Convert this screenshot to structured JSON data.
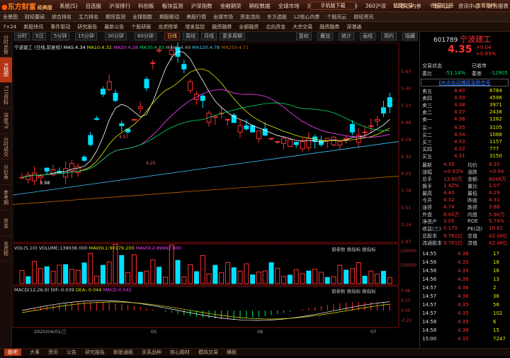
{
  "app": {
    "logo": "东方财富",
    "edition": "经典版",
    "quick_trade": "快捷交易",
    "login": "登录/注册",
    "user": "查看账户",
    "phone_download": "手机版下载"
  },
  "menu": [
    "系统(S)",
    "自选股",
    "沪深排行",
    "科创板",
    "板块监测",
    "沪深指数",
    "金融期货",
    "期权数据",
    "全球市场",
    "沪深港通",
    "美股市场",
    "360沪深",
    "L2核心内参",
    "个股风云",
    "资讯中心",
    "财务报表"
  ],
  "navbar": [
    "全景图",
    "财经要闻",
    "综合排名",
    "主力排名",
    "期货监测",
    "全球指数",
    "期股联动",
    "美股行情",
    "全球市场",
    "资金流向",
    "东方选股",
    "L2核心内参",
    "个股风云",
    "财经资讯",
    "7×24",
    "新股快讯",
    "事件驱动",
    "研究报告",
    "最新公告",
    "个股研报",
    "龙虎榜单",
    "增发监控",
    "融资融券",
    "全部融资",
    "北向资金",
    "大宗交易",
    "融资融券",
    "深港通"
  ],
  "left_tabs": [
    "分时走势",
    "K线图",
    "F10资料",
    "深度F9",
    "分时成交",
    "分价表",
    "参考期",
    "资金",
    "龙虎榜"
  ],
  "toolbar": {
    "items": [
      "分时",
      "5日",
      "5分钟",
      "15分钟",
      "30分钟",
      "60分钟",
      "日线",
      "周线",
      "月线",
      "更多周期"
    ],
    "active": "日线",
    "right_items": [
      "复权",
      "叠加",
      "统计",
      "画线",
      "简约",
      "隐藏"
    ]
  },
  "legend": {
    "stock": "宁波建工",
    "period": "(日线,前复权)",
    "ma": "MA",
    "ma5": "MA5:4.34",
    "ma10": "MA10:4.32",
    "ma20": "MA20:4.28",
    "ma30": "MA30:4.33",
    "ma60": "MA60:4.49",
    "ma120": "MA120:4.78",
    "ma250": "MA250:4.71"
  },
  "chart_annotations": {
    "high": "6.21",
    "low": "3.98",
    "mid_left": "4.57",
    "mid_low": "4.25"
  },
  "price_axis": [
    "5.67",
    "5.40",
    "5.13",
    "4.86",
    "4.59",
    "4.32",
    "4.05",
    "3.78",
    "3.51",
    "3.24",
    "2.97"
  ],
  "volume": {
    "label": "VOL(5,10)",
    "volume": "VOLUME:139038.000",
    "mavol1": "MAVOL1:90179.200",
    "mavol2": "MAVOL2:89962.800",
    "axis": [
      "200000",
      "100000"
    ]
  },
  "macd": {
    "label": "MACD(12,26,9)",
    "dif": "DIF:-0.039",
    "dea": "DEA:-0.044",
    "macd": "MACD:0.042",
    "axis": [
      "0.46",
      "0.23",
      "0.00",
      "-0.23"
    ]
  },
  "date_axis": [
    "2020/04/01/三",
    "05",
    "06",
    "07"
  ],
  "bottom_tabs": [
    "股吧",
    "大事",
    "资讯",
    "公告",
    "研究报告",
    "新股通板",
    "关系品种",
    "核心题材",
    "模拟交易",
    "横板"
  ],
  "panel_tools": [
    "窗参数",
    "换指标",
    "换指标"
  ],
  "quote": {
    "code": "601789",
    "name": "宁波建工",
    "price": "4.35",
    "change": "+0.04",
    "change_pct": "+0.93%",
    "status_label": "交易状态",
    "status_value": "已收市",
    "ratio_label": "委比",
    "ratio_value": "-51.14%",
    "diff_label": "委差",
    "diff_value": "-12905"
  },
  "signal": "DK点自动捕捉涨跌信号",
  "asks": [
    [
      "卖五",
      "4.40",
      "6784"
    ],
    [
      "卖四",
      "4.39",
      "4596"
    ],
    [
      "卖三",
      "4.38",
      "3971"
    ],
    [
      "卖二",
      "4.37",
      "2438"
    ],
    [
      "卖一",
      "4.36",
      "1282"
    ]
  ],
  "bids": [
    [
      "买一",
      "4.35",
      "3105"
    ],
    [
      "买二",
      "4.34",
      "1088"
    ],
    [
      "买三",
      "4.33",
      "1157"
    ],
    [
      "买四",
      "4.32",
      "777"
    ],
    [
      "买五",
      "4.31",
      "3150"
    ]
  ],
  "stats": [
    [
      "最新",
      "4.35",
      "均价",
      "4.35"
    ],
    [
      "涨幅",
      "+0.93%",
      "涨跌",
      "+0.04"
    ],
    [
      "总手",
      "13.90万",
      "金额",
      "6046万"
    ],
    [
      "换手",
      "1.42%",
      "量比",
      "1.07"
    ],
    [
      "最高",
      "4.40",
      "最低",
      "4.29"
    ],
    [
      "今开",
      "4.32",
      "昨收",
      "4.31"
    ],
    [
      "涨停",
      "4.74",
      "跌停",
      "3.88"
    ],
    [
      "外盘",
      "8.00万",
      "内盘",
      "5.90万"
    ],
    [
      "净资产",
      "3.05",
      "ROE",
      "5.74%"
    ],
    [
      "收益(三)",
      "0.175",
      "PE(动)",
      "18.61"
    ],
    [
      "总股本",
      "9.761亿",
      "总值",
      "42.46亿"
    ],
    [
      "流通股本",
      "9.761亿",
      "流值",
      "42.46亿"
    ]
  ],
  "ticks": [
    [
      "14:55",
      "4.36",
      "17"
    ],
    [
      "14:56",
      "4.35",
      "18"
    ],
    [
      "14:56",
      "4.35",
      "16"
    ],
    [
      "14:56",
      "4.36",
      "13"
    ],
    [
      "14:57",
      "4.36",
      "2"
    ],
    [
      "14:57",
      "4.36",
      "36"
    ],
    [
      "14:57",
      "4.35",
      "56"
    ],
    [
      "14:57",
      "4.35",
      "102"
    ],
    [
      "14:58",
      "4.35",
      "6"
    ],
    [
      "14:58",
      "4.36",
      "15"
    ],
    [
      "15:00",
      "4.35",
      "7247"
    ]
  ],
  "rp_tabs": [
    "分笔",
    "分价",
    "筹码"
  ]
}
